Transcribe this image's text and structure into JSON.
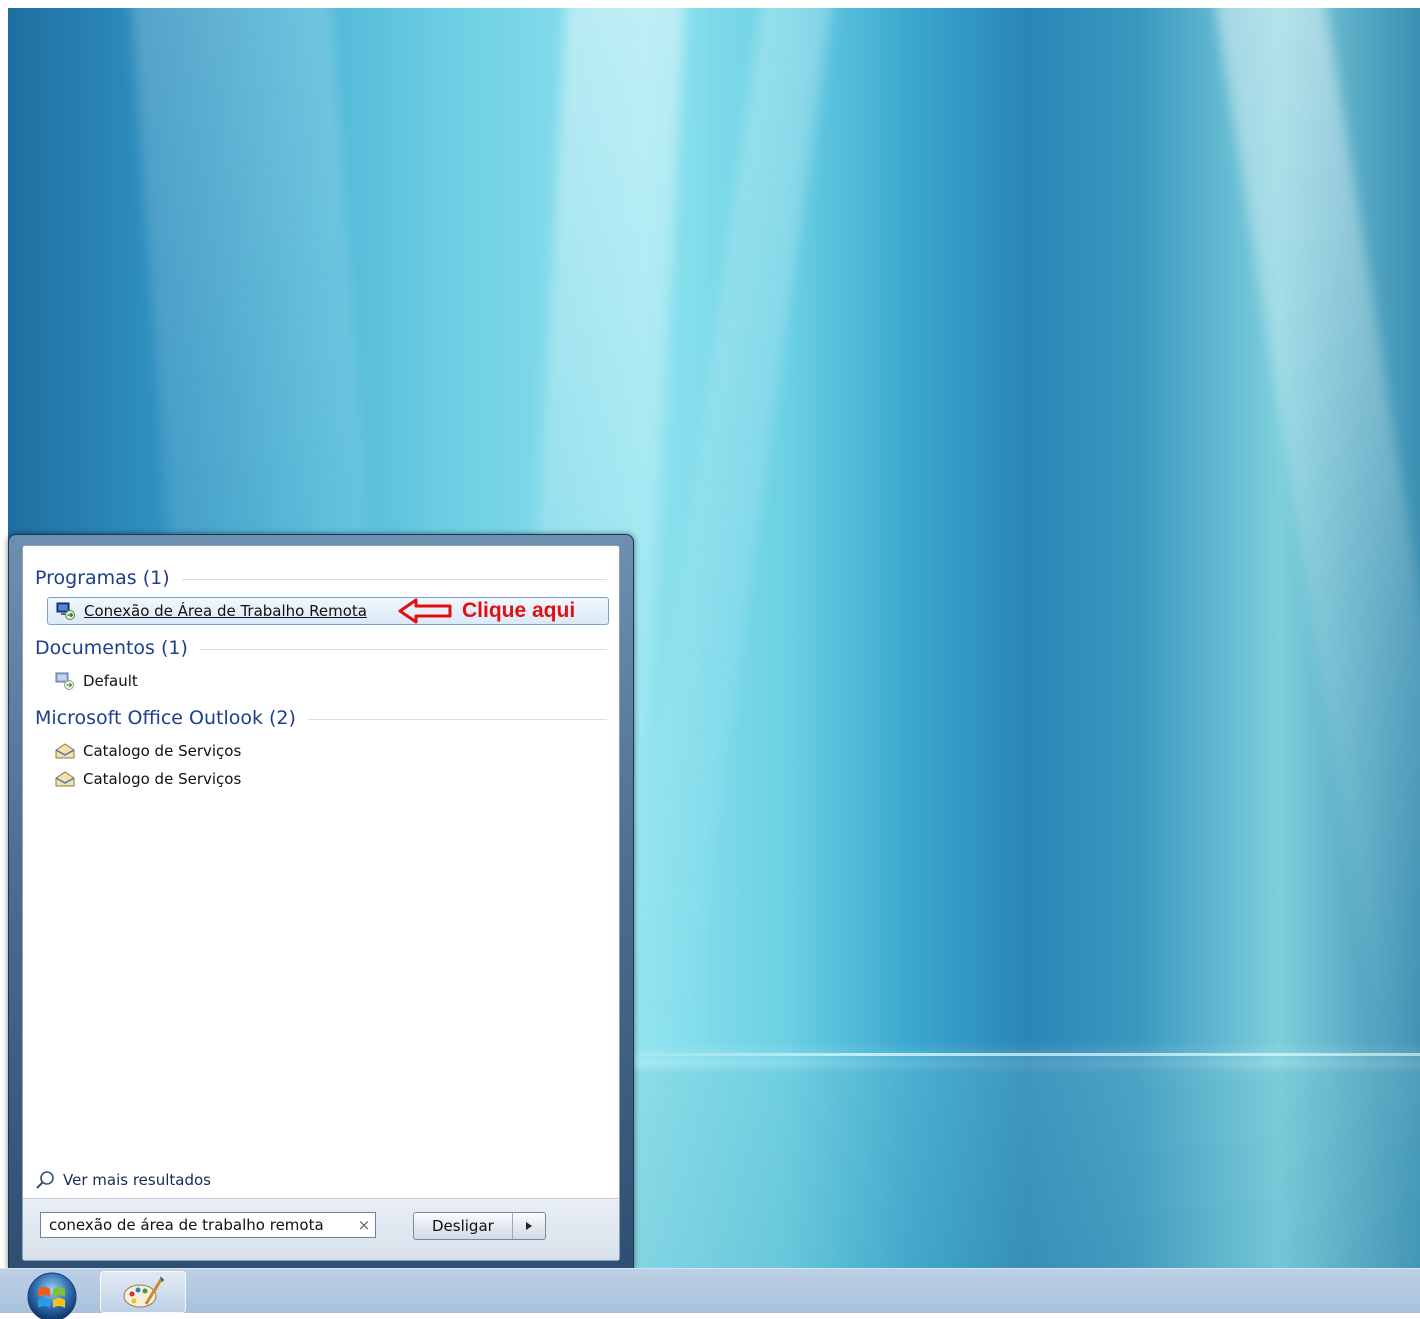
{
  "start_menu": {
    "sections": {
      "programas": {
        "title": "Programas (1)",
        "items": [
          {
            "label": "Conexão de Área de Trabalho Remota",
            "icon": "remote-desktop-icon"
          }
        ]
      },
      "documentos": {
        "title": "Documentos (1)",
        "items": [
          {
            "label": "Default",
            "icon": "remote-desktop-file-icon"
          }
        ]
      },
      "outlook": {
        "title": "Microsoft Office Outlook (2)",
        "items": [
          {
            "label": "Catalogo de Serviços",
            "icon": "outlook-envelope-icon"
          },
          {
            "label": "Catalogo de Serviços",
            "icon": "outlook-envelope-icon"
          }
        ]
      }
    },
    "annotation": {
      "text": "Clique aqui",
      "color": "#e01010"
    },
    "see_more": "Ver mais resultados",
    "search": {
      "value": "conexão de área de trabalho remota",
      "clear_symbol": "×"
    },
    "shutdown_label": "Desligar"
  },
  "taskbar": {
    "items": [
      {
        "icon": "windows-start-orb-icon"
      },
      {
        "icon": "paint-icon"
      }
    ]
  }
}
